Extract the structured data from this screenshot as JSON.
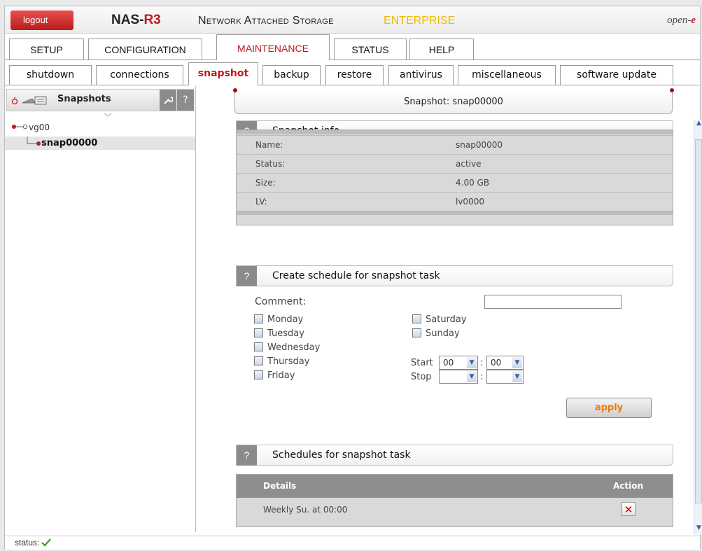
{
  "header": {
    "logout": "logout",
    "brand_nas": "NAS-",
    "brand_r3": "R3",
    "brand_network": "Network Attached Storage",
    "brand_enterprise": "ENTERPRISE",
    "brand_open": "open-",
    "brand_e": "e"
  },
  "main_tabs": [
    "SETUP",
    "CONFIGURATION",
    "MAINTENANCE",
    "STATUS",
    "HELP"
  ],
  "sub_tabs": [
    "shutdown",
    "connections",
    "snapshot",
    "backup",
    "restore",
    "antivirus",
    "miscellaneous",
    "software update"
  ],
  "left": {
    "title": "Snapshots",
    "help": "?",
    "vg": "vg00",
    "snap": "snap00000"
  },
  "title_bar": "Snapshot: snap00000",
  "info": {
    "heading": "Snapshot info",
    "rows": [
      {
        "k": "Name:",
        "v": "snap00000"
      },
      {
        "k": "Status:",
        "v": "active"
      },
      {
        "k": "Size:",
        "v": "4.00 GB"
      },
      {
        "k": "LV:",
        "v": "lv0000"
      }
    ]
  },
  "schedule": {
    "heading": "Create schedule for snapshot task",
    "comment_label": "Comment:",
    "comment_value": "",
    "days_left": [
      "Monday",
      "Tuesday",
      "Wednesday",
      "Thursday",
      "Friday"
    ],
    "days_right": [
      "Saturday",
      "Sunday"
    ],
    "start_label": "Start",
    "stop_label": "Stop",
    "start_h": "00",
    "start_m": "00",
    "stop_h": "",
    "stop_m": "",
    "colon": ":",
    "apply": "apply"
  },
  "schedules": {
    "heading": "Schedules for snapshot task",
    "col_details": "Details",
    "col_action": "Action",
    "row": "Weekly Su. at 00:00"
  },
  "status": {
    "label": "status:"
  },
  "colors": {
    "accent_red": "#c0181c",
    "apply_orange": "#f07a00",
    "enterprise_yellow": "#f0b800"
  }
}
